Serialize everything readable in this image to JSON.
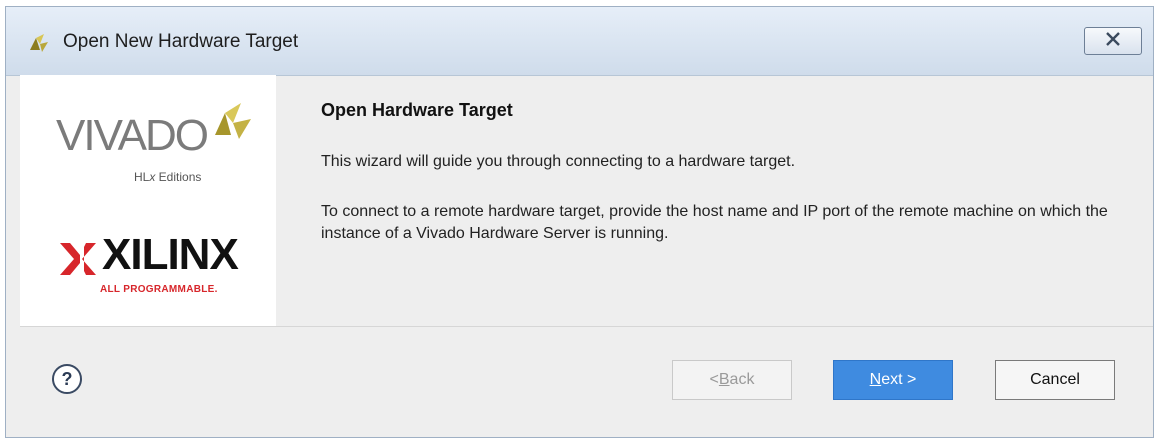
{
  "window": {
    "title": "Open New Hardware Target"
  },
  "branding": {
    "vivado_logo_text": "VIVADO",
    "vivado_subtitle_pre": "HL",
    "vivado_subtitle_x": "x",
    "vivado_subtitle_post": " Editions",
    "xilinx_logo_text": "XILINX",
    "xilinx_tagline": "ALL PROGRAMMABLE."
  },
  "content": {
    "title": "Open Hardware Target",
    "paragraph1": "This wizard will guide you through connecting to a hardware target.",
    "paragraph2": "To connect to a remote hardware target, provide the host name and IP port of the remote machine on which the instance of a Vivado Hardware Server is running."
  },
  "footer": {
    "back_prefix": "< ",
    "back_mnemonic": "B",
    "back_rest": "ack",
    "next_mnemonic": "N",
    "next_rest": "ext >",
    "cancel_label": "Cancel"
  },
  "colors": {
    "accent_button": "#3f8be0",
    "titlebar": "#d6e2ef",
    "xilinx_red": "#d7262b",
    "vivado_gold": "#c9b54a"
  }
}
